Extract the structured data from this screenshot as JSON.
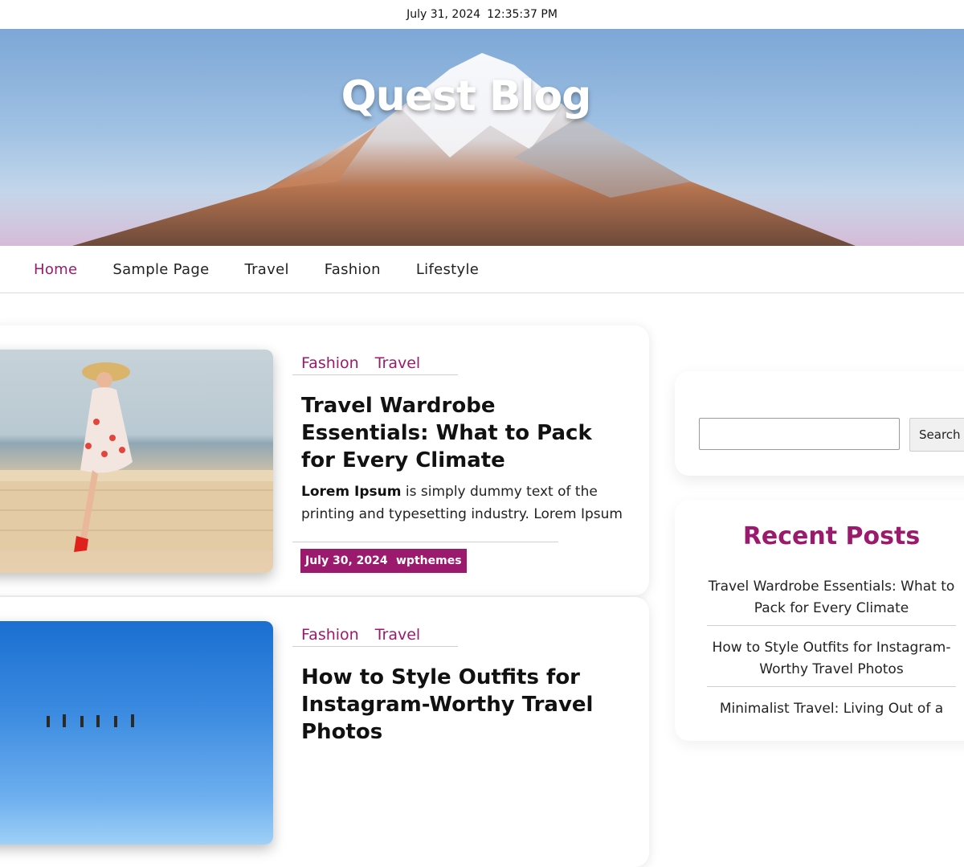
{
  "topbar": {
    "date": "July 31, 2024",
    "time": "12:35:37 PM"
  },
  "site": {
    "title": "Quest Blog"
  },
  "nav": {
    "items": [
      {
        "label": "Home"
      },
      {
        "label": "Sample Page"
      },
      {
        "label": "Travel"
      },
      {
        "label": "Fashion"
      },
      {
        "label": "Lifestyle"
      }
    ]
  },
  "posts": [
    {
      "categories": [
        "Fashion",
        "Travel"
      ],
      "title": "Travel Wardrobe Essentials: What to Pack for Every Climate",
      "excerpt_bold": "Lorem Ipsum",
      "excerpt_rest": " is simply dummy text of the printing and typesetting industry. Lorem Ipsum",
      "date": "July 30, 2024",
      "author": "wpthemes"
    },
    {
      "categories": [
        "Fashion",
        "Travel"
      ],
      "title": "How to Style Outfits for Instagram-Worthy Travel Photos"
    }
  ],
  "sidebar": {
    "search_button": "Search",
    "search_placeholder": "",
    "recent_title": "Recent Posts",
    "recent_posts": [
      "Travel Wardrobe Essentials: What to Pack for Every Climate",
      "How to Style Outfits for Instagram-Worthy Travel Photos",
      "Minimalist Travel: Living Out of a"
    ]
  },
  "colors": {
    "accent": "#9c1a6d"
  }
}
